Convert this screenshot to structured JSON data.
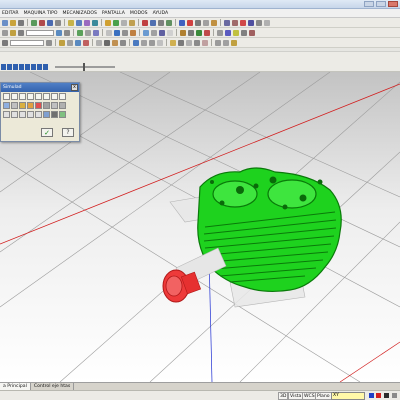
{
  "menu": {
    "items": [
      "EDITAR",
      "MAQUINA TIPO",
      "MECANIZADOS",
      "PANTALLA",
      "MODOS",
      "AYUDA"
    ]
  },
  "simulator": {
    "title": "Simulad",
    "close_label": "x",
    "ok_label": "✓",
    "help_label": "?"
  },
  "tabs": [
    "a Principal",
    "Control eje htas"
  ],
  "status": {
    "mode_3d": "3D",
    "view": "Vista",
    "wcs": "WCS",
    "plane": "Plano",
    "plane_value": "XY"
  },
  "colors": {
    "part": "#1ed21e",
    "part_dark": "#0a7a0a",
    "tool": "#ee3a3a",
    "axis_x": "#d21e1e",
    "axis_y": "#1e2ed2",
    "toolbar_bg": "#ecebe6"
  },
  "icons": {
    "part": "cylinder-head-model",
    "tool": "cutting-tool-holder",
    "ok": "checkmark-icon",
    "help": "help-icon"
  }
}
